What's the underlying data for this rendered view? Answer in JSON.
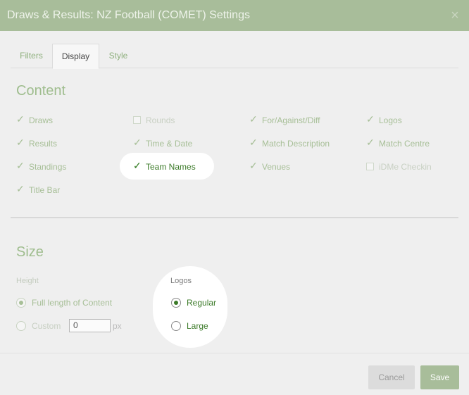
{
  "window": {
    "title": "Draws & Results: NZ Football (COMET) Settings",
    "close_symbol": "×"
  },
  "tabs": [
    {
      "label": "Filters",
      "active": false
    },
    {
      "label": "Display",
      "active": true
    },
    {
      "label": "Style",
      "active": false
    }
  ],
  "content_section": {
    "title": "Content",
    "checkboxes": [
      {
        "label": "Draws",
        "checked": true
      },
      {
        "label": "Rounds",
        "checked": false
      },
      {
        "label": "For/Against/Diff",
        "checked": true
      },
      {
        "label": "Logos",
        "checked": true
      },
      {
        "label": "Results",
        "checked": true
      },
      {
        "label": "Time & Date",
        "checked": true
      },
      {
        "label": "Match Description",
        "checked": true
      },
      {
        "label": "Match Centre",
        "checked": true
      },
      {
        "label": "Standings",
        "checked": true
      },
      {
        "label": "Team Names",
        "checked": true
      },
      {
        "label": "Venues",
        "checked": true
      },
      {
        "label": "iDMe Checkin",
        "checked": false
      },
      {
        "label": "Title Bar",
        "checked": true
      }
    ]
  },
  "size_section": {
    "title": "Size",
    "height_label": "Height",
    "height_options": [
      {
        "label": "Full length of Content",
        "selected": true
      },
      {
        "label": "Custom",
        "selected": false
      }
    ],
    "custom_value": "0",
    "custom_unit": "px",
    "logos_label": "Logos",
    "logos_options": [
      {
        "label": "Regular",
        "selected": true
      },
      {
        "label": "Large",
        "selected": false
      }
    ]
  },
  "footer": {
    "cancel_label": "Cancel",
    "save_label": "Save"
  },
  "check_symbol": "✓"
}
